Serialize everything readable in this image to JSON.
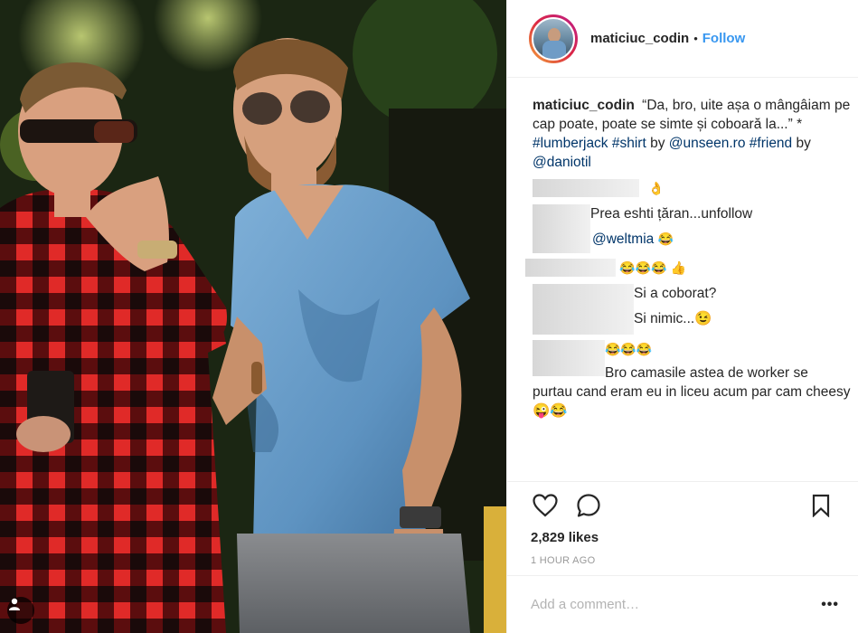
{
  "header": {
    "username": "maticiuc_codin",
    "separator": "•",
    "follow_label": "Follow"
  },
  "caption": {
    "username": "maticiuc_codin",
    "text": "“Da, bro, uite așa o mângâiam pe cap poate, poate se simte și coboară la...” *",
    "hashtag1": "#lumberjack",
    "hashtag2": "#shirt",
    "by1": "by",
    "mention1": "@unseen.ro",
    "hashtag3": "#friend",
    "by2": "by",
    "mention2": "@daniotil"
  },
  "comments": [
    {
      "text": "👌"
    },
    {
      "text": "Prea eshti țăran...unfollow"
    },
    {
      "mention": "@weltmia",
      "text": "😂"
    },
    {
      "text": "😂😂😂 👍"
    },
    {
      "text": "Si a coborat?"
    },
    {
      "text": "Si nimic...😉"
    },
    {
      "text": "😂😂😂"
    },
    {
      "text": "Bro camasile astea de worker se purtau cand eram eu in liceu acum par cam cheesy 😜😂"
    }
  ],
  "actions": {
    "like_icon": "heart-outline",
    "comment_icon": "speech-bubble",
    "save_icon": "bookmark"
  },
  "likes": "2,829 likes",
  "timestamp": "1 hour ago",
  "add_comment": {
    "placeholder": "Add a comment…",
    "more_label": "•••"
  },
  "colors": {
    "link": "#3897f0",
    "hashtag": "#003569",
    "muted": "#999999",
    "border": "#efefef"
  }
}
